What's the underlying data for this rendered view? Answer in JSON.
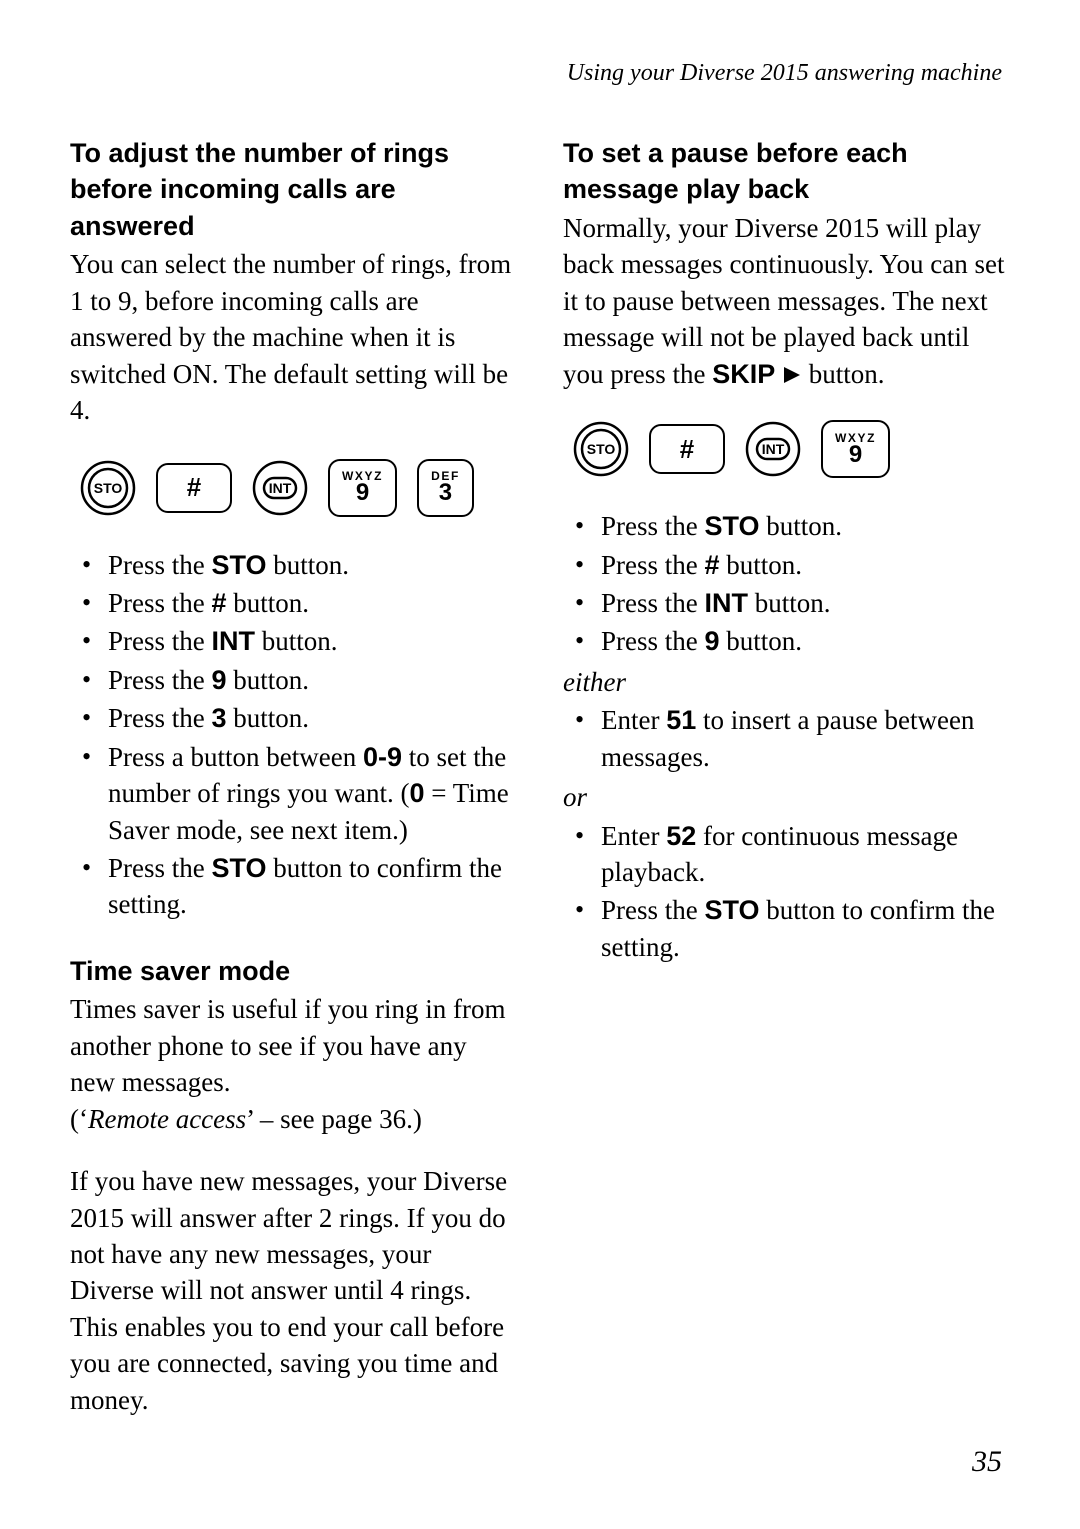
{
  "running_head": "Using your Diverse 2015 answering machine",
  "page_number": "35",
  "keys": {
    "sto": "STO",
    "hash": "#",
    "int": "INT",
    "nine_top": "WXYZ",
    "nine_bot": "9",
    "three_top": "DEF",
    "three_bot": "3"
  },
  "left": {
    "sec1": {
      "heading": "To adjust the number of rings before incoming calls are answered",
      "intro": "You can select the number of rings, from 1 to 9, before incoming calls are answered by the machine when it is switched ON. The default setting will be 4.",
      "steps": {
        "s1a": "Press the ",
        "s1b": "STO",
        "s1c": " button.",
        "s2a": "Press the ",
        "s2b": "#",
        "s2c": " button.",
        "s3a": "Press the ",
        "s3b": "INT",
        "s3c": " button.",
        "s4a": "Press the ",
        "s4b": "9",
        "s4c": " button.",
        "s5a": "Press the ",
        "s5b": "3",
        "s5c": " button.",
        "s6a": "Press a button between ",
        "s6b": "0-9",
        "s6c": " to set the number of rings you want. (",
        "s6d": "0",
        "s6e": " = Time Saver mode, see next item.)",
        "s7a": "Press the ",
        "s7b": "STO",
        "s7c": " button to confirm the setting."
      }
    },
    "sec2": {
      "heading": "Time saver mode",
      "p1a": "Times saver is useful if you ring in from another phone to see if you have any new messages.",
      "p1b_open": "(‘",
      "p1b_ital": "Remote access",
      "p1b_close": "’ – see page 36.)",
      "p2": "If you have new messages, your Diverse 2015 will answer after 2 rings. If you do not have any new messages, your Diverse will not answer until 4 rings. This enables you to end your call before you are connected, saving you time and money."
    }
  },
  "right": {
    "sec1": {
      "heading": "To set a pause before each message play back",
      "intro_a": "Normally, your Diverse 2015 will play back messages continuously. You can set it to pause between messages. The next message will not be played back until you press the ",
      "intro_b": "SKIP",
      "intro_c": " button.",
      "steps": {
        "s1a": "Press the ",
        "s1b": "STO",
        "s1c": " button.",
        "s2a": "Press the ",
        "s2b": "#",
        "s2c": " button.",
        "s3a": "Press the ",
        "s3b": "INT",
        "s3c": " button.",
        "s4a": "Press the ",
        "s4b": "9",
        "s4c": " button."
      },
      "either": "either",
      "either_step_a": "Enter ",
      "either_step_b": "51",
      "either_step_c": " to insert a pause between messages.",
      "or": "or",
      "or_step1_a": "Enter ",
      "or_step1_b": "52",
      "or_step1_c": " for continuous message playback.",
      "or_step2_a": "Press the ",
      "or_step2_b": "STO",
      "or_step2_c": " button to confirm the setting."
    }
  }
}
